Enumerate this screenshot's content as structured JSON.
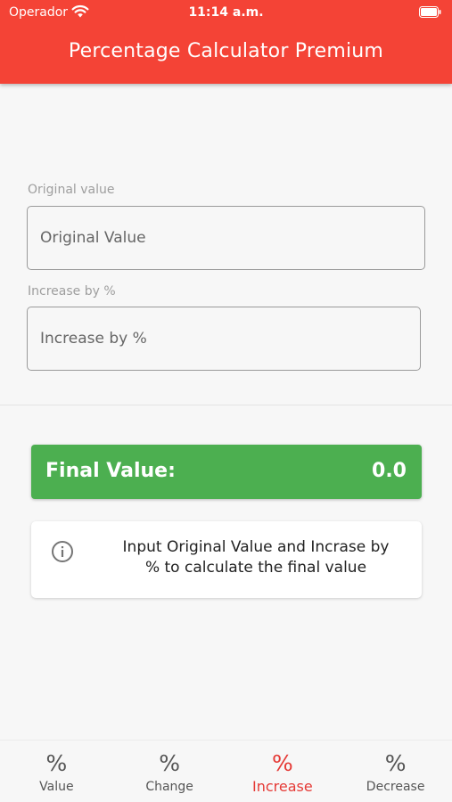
{
  "status_bar": {
    "carrier": "Operador",
    "time": "11:14 a.m."
  },
  "app_bar": {
    "title": "Percentage Calculator Premium",
    "color": "#f44336"
  },
  "form": {
    "original_label": "Original value",
    "original_placeholder": "Original Value",
    "original_value": "",
    "increase_label": "Increase by %",
    "increase_placeholder": "Increase by %",
    "increase_value": ""
  },
  "result": {
    "label": "Final Value:",
    "value": "0.0",
    "color": "#4caf50"
  },
  "info": {
    "icon": "info-icon",
    "text": "Input Original Value and Incrase by % to calculate the final value"
  },
  "bottom_nav": {
    "active": "Increase",
    "items": [
      {
        "label": "Value",
        "icon": "percent-icon"
      },
      {
        "label": "Change",
        "icon": "percent-icon"
      },
      {
        "label": "Increase",
        "icon": "percent-icon"
      },
      {
        "label": "Decrease",
        "icon": "percent-icon"
      }
    ],
    "icon_glyph": "%"
  }
}
